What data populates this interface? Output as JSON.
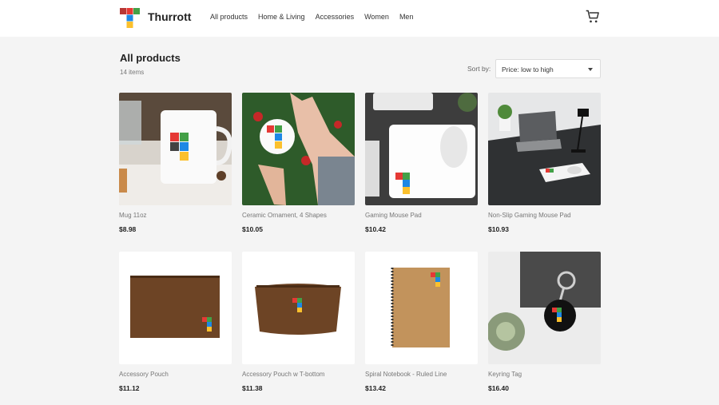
{
  "header": {
    "brand": "Thurrott",
    "nav": [
      "All products",
      "Home & Living",
      "Accessories",
      "Women",
      "Men"
    ]
  },
  "page": {
    "title": "All products",
    "count": "14 items",
    "sort_label": "Sort by:",
    "sort_value": "Price: low to high"
  },
  "products": [
    {
      "name": "Mug 11oz",
      "price": "$8.98"
    },
    {
      "name": "Ceramic Ornament, 4 Shapes",
      "price": "$10.05"
    },
    {
      "name": "Gaming Mouse Pad",
      "price": "$10.42"
    },
    {
      "name": "Non-Slip Gaming Mouse Pad",
      "price": "$10.93"
    },
    {
      "name": "Accessory Pouch",
      "price": "$11.12"
    },
    {
      "name": "Accessory Pouch w T-bottom",
      "price": "$11.38"
    },
    {
      "name": "Spiral Notebook - Ruled Line",
      "price": "$13.42"
    },
    {
      "name": "Keyring Tag",
      "price": "$16.40"
    }
  ],
  "colors": {
    "logo_red": "#e53935",
    "logo_green": "#43a047",
    "logo_blue": "#1e88e5",
    "logo_yellow": "#fbc02d"
  }
}
